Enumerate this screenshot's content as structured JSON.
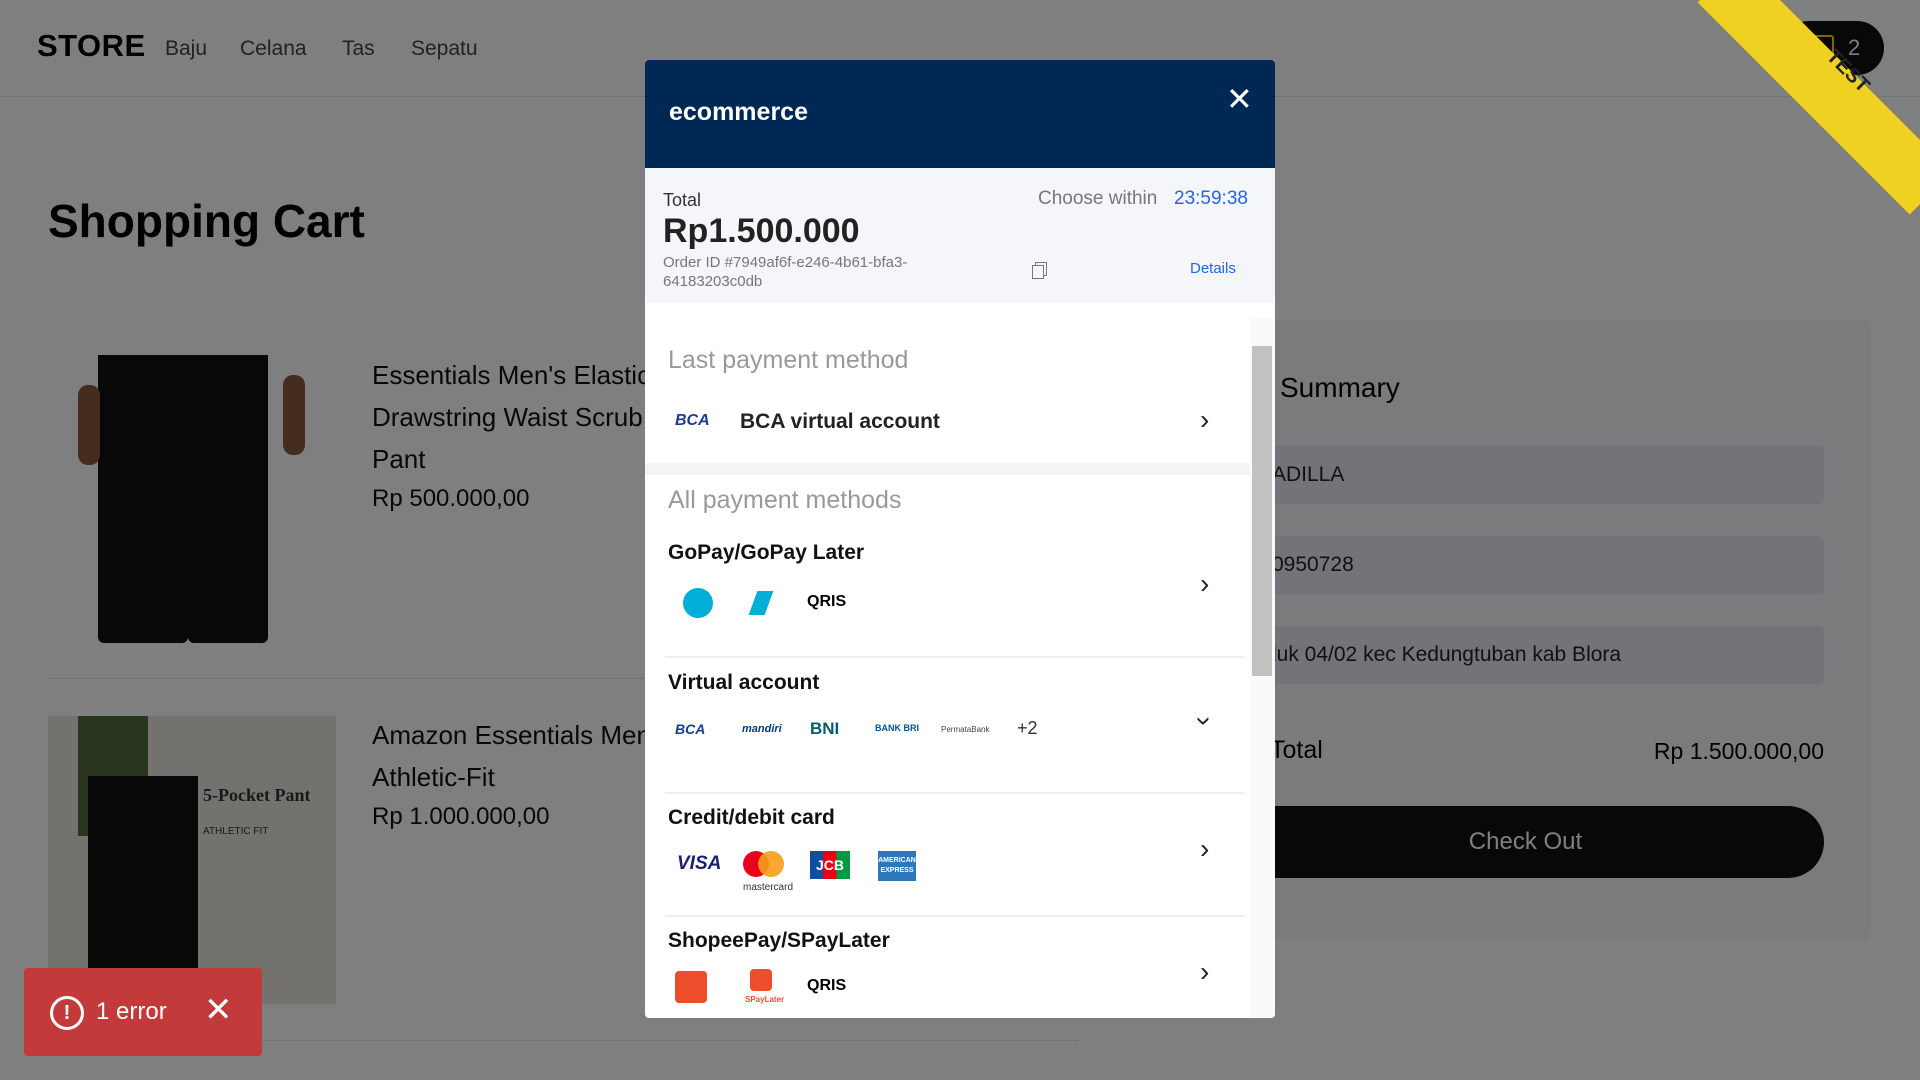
{
  "nav": {
    "brand": "STORE",
    "links": [
      "Baju",
      "Celana",
      "Tas",
      "Sepatu"
    ],
    "cart_count": "2"
  },
  "page": {
    "title": "Shopping Cart"
  },
  "products": [
    {
      "name": "Essentials Men's Elastic Drawstring Waist Scrub Pant",
      "price": "Rp 500.000,00"
    },
    {
      "name": "Amazon Essentials Men's Athletic-Fit",
      "price": "Rp 1.000.000,00",
      "image_text": "5-Pocket Pant",
      "image_sub": "ATHLETIC FIT"
    }
  ],
  "summary": {
    "title": "Summary",
    "name_value": "ADILLA",
    "phone_value": "0950728",
    "address_value": "luk 04/02 kec Kedungtuban kab Blora",
    "total_label": "Total",
    "total_value": "Rp 1.500.000,00",
    "checkout_label": "Check Out"
  },
  "ribbon": "TEST",
  "error_toast": {
    "text": "1 error"
  },
  "modal": {
    "brand": "ecommerce",
    "total_label": "Total",
    "choose_within": "Choose within",
    "timer": "23:59:38",
    "amount": "Rp1.500.000",
    "order_id": "Order ID #7949af6f-e246-4b61-bfa3-64183203c0db",
    "details_label": "Details",
    "last_method_title": "Last payment method",
    "last_method": "BCA virtual account",
    "all_methods_title": "All payment methods",
    "methods": [
      {
        "title": "GoPay/GoPay Later",
        "logos": [
          "gopay-icon",
          "gopaylater-icon",
          "qris-logo"
        ]
      },
      {
        "title": "Virtual account",
        "logos": [
          "BCA",
          "mandiri",
          "BNI",
          "BANK BRI",
          "PermataBank"
        ],
        "more": "+2"
      },
      {
        "title": "Credit/debit card",
        "logos": [
          "VISA",
          "mastercard",
          "JCB",
          "AMERICAN EXPRESS"
        ]
      },
      {
        "title": "ShopeePay/SPayLater",
        "logos": [
          "shopeepay-icon",
          "SPayLater",
          "qris-logo"
        ]
      }
    ]
  },
  "colors": {
    "modal_header": "#002855",
    "accent": "#2563eb",
    "error": "#c23a3a",
    "ribbon": "#f0d020"
  }
}
